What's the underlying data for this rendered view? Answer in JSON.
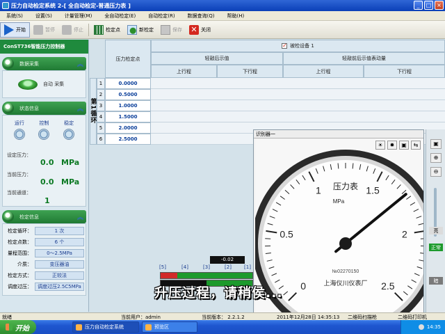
{
  "window": {
    "title": "压力自动检定系统 2-[ 全自动检定-普通压力表 ]",
    "minimize": "_",
    "maximize": "□",
    "close": "×"
  },
  "menu": [
    "系统(S)",
    "设置(S)",
    "计量管理(M)",
    "全自动检定(E)",
    "自动检定(R)",
    "数据查询(Q)",
    "帮助(H)"
  ],
  "toolbar": {
    "start": "开始",
    "pause": "暂停",
    "stop": "停止",
    "checkpoint": "检定点",
    "new_check": "新检定",
    "save": "保存",
    "close": "关闭"
  },
  "left_panel": {
    "header": "ConST736智能压力控制器",
    "acquisition": {
      "title": "数据采集",
      "button_label": "自动 采集"
    },
    "status": {
      "title": "状态信息",
      "indicators": [
        "运行",
        "控制",
        "稳定"
      ],
      "set_pressure_label": "设定压力：",
      "set_pressure_value": "0.0",
      "set_pressure_unit": "MPa",
      "current_pressure_label": "当前压力：",
      "current_pressure_value": "0.0",
      "current_pressure_unit": "MPa",
      "current_channel_label": "当前通道：",
      "current_channel_value": "1"
    },
    "check_info": {
      "title": "检定信息",
      "rows": [
        {
          "label": "检定循环：",
          "value": "1 次"
        },
        {
          "label": "检定点数：",
          "value": "6 个"
        },
        {
          "label": "量程范围：",
          "value": "0～2.5MPa"
        },
        {
          "label": "介质：",
          "value": "变压器油"
        },
        {
          "label": "检定方式：",
          "value": "正较法"
        },
        {
          "label": "调度过压：",
          "value": "调度过压2.5C5MPa"
        }
      ]
    }
  },
  "table": {
    "device_label": "被检设备 1",
    "device_checked": "✓",
    "pressure_point_header": "压力检定点",
    "group_after_tap": "轻敲后示值",
    "group_before_tap": "轻敲前后示值表动量",
    "upstroke": "上行程",
    "downstroke": "下行程",
    "cycle_label": "第1循环",
    "rows": [
      {
        "no": "1",
        "point": "0.0000"
      },
      {
        "no": "2",
        "point": "0.5000"
      },
      {
        "no": "3",
        "point": "1.0000"
      },
      {
        "no": "4",
        "point": "1.5000"
      },
      {
        "no": "5",
        "point": "2.0000"
      },
      {
        "no": "6",
        "point": "2.5000"
      }
    ]
  },
  "gauge_window": {
    "title": "识别器一",
    "face_title": "压力表",
    "unit": "MPa",
    "manufacturer": "上海仪川仪表厂",
    "serial": "№02270150",
    "scale_labels": [
      "0",
      "0.5",
      "1",
      "1.5",
      "2",
      "2.5"
    ],
    "needle_value": 1.72,
    "tools": [
      "☀",
      "✹",
      "▣",
      "⇆"
    ]
  },
  "indicator": {
    "readout": "-0.02",
    "boxes": [
      "[5]",
      "[4]",
      "[3]",
      "[2]",
      "[1]"
    ]
  },
  "right_bar": {
    "label_top": "亮",
    "label_mid": "正常",
    "label_bot": "暗"
  },
  "subtitle": "升压过程，请稍侯...",
  "statusbar": {
    "ready": "就绪",
    "user": "当前用户：admin",
    "version": "当前版本：  2.2.1.2",
    "datetime": "2011年12月28日 14:35:13",
    "scanner": "二维码扫描枪",
    "printer": "二维码打印机"
  },
  "taskbar": {
    "start": "开始",
    "tasks": [
      "压力自动检定系统",
      "预览区"
    ],
    "clock": "14:35"
  }
}
